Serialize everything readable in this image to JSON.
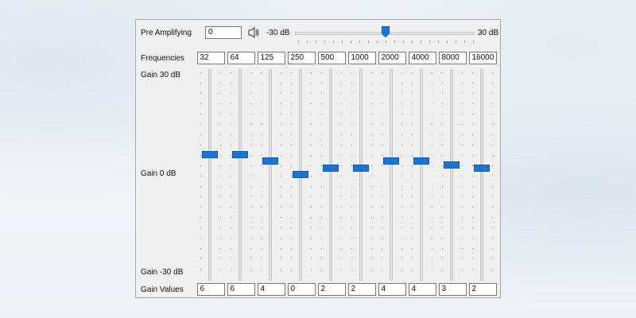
{
  "pre_amp": {
    "label": "Pre Amplifying",
    "value": "0",
    "min_label": "-30 dB",
    "max_label": "30 dB",
    "level": 0
  },
  "frequencies": {
    "label": "Frequencies",
    "values": [
      "32",
      "64",
      "125",
      "250",
      "500",
      "1000",
      "2000",
      "4000",
      "8000",
      "16000"
    ]
  },
  "gain_axis": {
    "top": "Gain 30 dB",
    "middle": "Gain 0 dB",
    "bottom": "Gain -30 dB"
  },
  "gain_values": {
    "label": "Gain Values",
    "values": [
      "6",
      "6",
      "4",
      "0",
      "2",
      "2",
      "4",
      "4",
      "3",
      "2"
    ]
  },
  "colors": {
    "accent": "#1a74d6",
    "window_bg": "#f0f0f0"
  },
  "icons": {
    "volume": "speaker-icon"
  }
}
